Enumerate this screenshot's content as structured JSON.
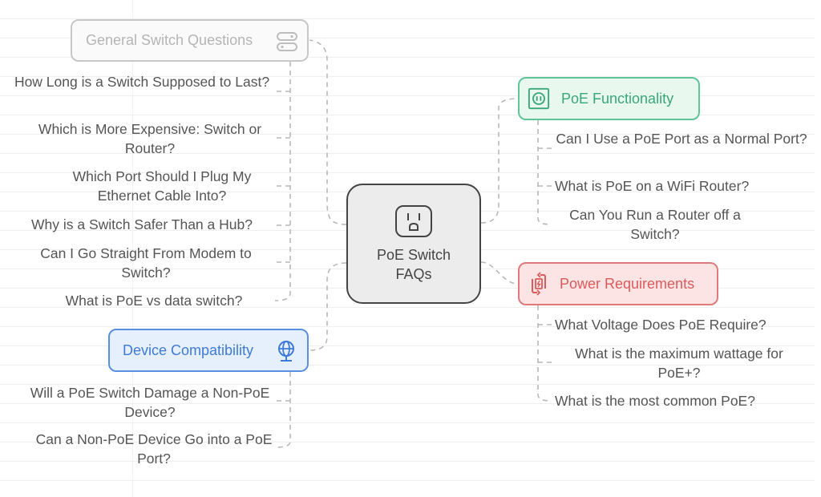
{
  "diagram": {
    "type": "mind-map",
    "center": {
      "label": "PoE Switch FAQs",
      "icon": "power-outlet-icon"
    },
    "branches": [
      {
        "id": "general",
        "label": "General Switch Questions",
        "icon": "toggle-switches-icon",
        "color": "#b5b5b5",
        "questions": [
          "How Long is a Switch Supposed to Last?",
          "Which is More Expensive: Switch or Router?",
          "Which Port Should I Plug My Ethernet Cable Into?",
          "Why is a Switch Safer Than a Hub?",
          "Can I Go Straight From Modem to Switch?",
          "What is PoE vs data switch?"
        ]
      },
      {
        "id": "poe",
        "label": "PoE Functionality",
        "icon": "outlet-icon",
        "color": "#3aa777",
        "questions": [
          "Can I Use a PoE Port as a Normal Port?",
          "What is PoE on a WiFi Router?",
          "Can You Run a Router off a Switch?"
        ]
      },
      {
        "id": "power",
        "label": "Power Requirements",
        "icon": "battery-cycle-icon",
        "color": "#d95b5b",
        "questions": [
          "What Voltage Does PoE Require?",
          "What is the maximum wattage for PoE+?",
          "What is the most common PoE?"
        ]
      },
      {
        "id": "device",
        "label": "Device Compatibility",
        "icon": "globe-icon",
        "color": "#3f7bd6",
        "questions": [
          "Will a PoE Switch Damage a Non-PoE Device?",
          "Can a Non-PoE Device Go into a PoE Port?"
        ]
      }
    ]
  }
}
